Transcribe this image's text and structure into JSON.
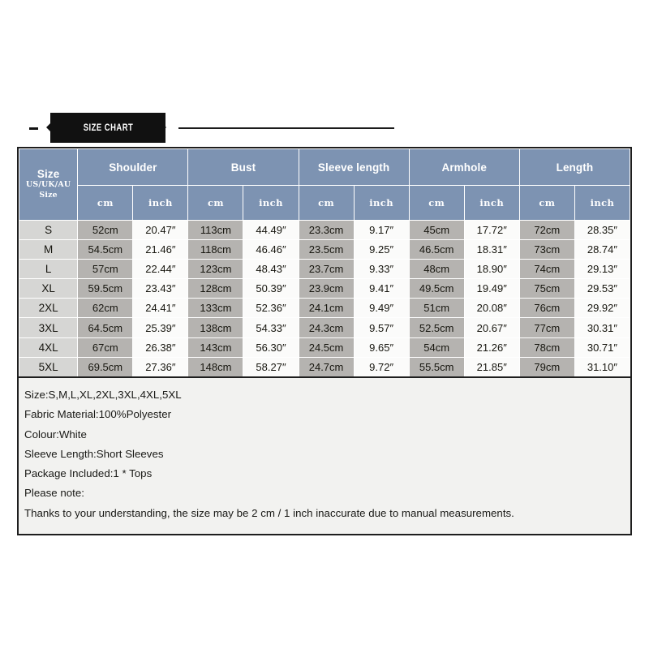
{
  "banner": {
    "title": "SIZE CHART",
    "accent_color": "#111111"
  },
  "theme": {
    "header_blue": "#7d93b2",
    "cm_cell_gray": "#b5b3b0",
    "inch_cell": "#fbfbfa",
    "size_cell_gray": "#d6d6d4",
    "border_dark": "#1e1e1e",
    "panel_bg": "#f2f2f0",
    "page_bg": "#ffffff"
  },
  "table": {
    "group_headers": [
      "Size",
      "Shoulder",
      "Bust",
      "Sleeve length",
      "Armhole",
      "Length"
    ],
    "size_subheader_line1": "US/UK/AU",
    "size_subheader_line2": "Size",
    "unit_headers": [
      "cm",
      "inch",
      "cm",
      "inch",
      "cm",
      "inch",
      "cm",
      "inch",
      "cm",
      "inch"
    ],
    "rows": [
      {
        "size": "S",
        "shoulder_cm": "52cm",
        "shoulder_inch": "20.47″",
        "bust_cm": "113cm",
        "bust_inch": "44.49″",
        "sleeve_cm": "23.3cm",
        "sleeve_inch": "9.17″",
        "armhole_cm": "45cm",
        "armhole_inch": "17.72″",
        "length_cm": "72cm",
        "length_inch": "28.35″"
      },
      {
        "size": "M",
        "shoulder_cm": "54.5cm",
        "shoulder_inch": "21.46″",
        "bust_cm": "118cm",
        "bust_inch": "46.46″",
        "sleeve_cm": "23.5cm",
        "sleeve_inch": "9.25″",
        "armhole_cm": "46.5cm",
        "armhole_inch": "18.31″",
        "length_cm": "73cm",
        "length_inch": "28.74″"
      },
      {
        "size": "L",
        "shoulder_cm": "57cm",
        "shoulder_inch": "22.44″",
        "bust_cm": "123cm",
        "bust_inch": "48.43″",
        "sleeve_cm": "23.7cm",
        "sleeve_inch": "9.33″",
        "armhole_cm": "48cm",
        "armhole_inch": "18.90″",
        "length_cm": "74cm",
        "length_inch": "29.13″"
      },
      {
        "size": "XL",
        "shoulder_cm": "59.5cm",
        "shoulder_inch": "23.43″",
        "bust_cm": "128cm",
        "bust_inch": "50.39″",
        "sleeve_cm": "23.9cm",
        "sleeve_inch": "9.41″",
        "armhole_cm": "49.5cm",
        "armhole_inch": "19.49″",
        "length_cm": "75cm",
        "length_inch": "29.53″"
      },
      {
        "size": "2XL",
        "shoulder_cm": "62cm",
        "shoulder_inch": "24.41″",
        "bust_cm": "133cm",
        "bust_inch": "52.36″",
        "sleeve_cm": "24.1cm",
        "sleeve_inch": "9.49″",
        "armhole_cm": "51cm",
        "armhole_inch": "20.08″",
        "length_cm": "76cm",
        "length_inch": "29.92″"
      },
      {
        "size": "3XL",
        "shoulder_cm": "64.5cm",
        "shoulder_inch": "25.39″",
        "bust_cm": "138cm",
        "bust_inch": "54.33″",
        "sleeve_cm": "24.3cm",
        "sleeve_inch": "9.57″",
        "armhole_cm": "52.5cm",
        "armhole_inch": "20.67″",
        "length_cm": "77cm",
        "length_inch": "30.31″"
      },
      {
        "size": "4XL",
        "shoulder_cm": "67cm",
        "shoulder_inch": "26.38″",
        "bust_cm": "143cm",
        "bust_inch": "56.30″",
        "sleeve_cm": "24.5cm",
        "sleeve_inch": "9.65″",
        "armhole_cm": "54cm",
        "armhole_inch": "21.26″",
        "length_cm": "78cm",
        "length_inch": "30.71″"
      },
      {
        "size": "5XL",
        "shoulder_cm": "69.5cm",
        "shoulder_inch": "27.36″",
        "bust_cm": "148cm",
        "bust_inch": "58.27″",
        "sleeve_cm": "24.7cm",
        "sleeve_inch": "9.72″",
        "armhole_cm": "55.5cm",
        "armhole_inch": "21.85″",
        "length_cm": "79cm",
        "length_inch": "31.10″"
      }
    ]
  },
  "description": {
    "lines": [
      "Size:S,M,L,XL,2XL,3XL,4XL,5XL",
      "Fabric Material:100%Polyester",
      "Colour:White",
      "Sleeve Length:Short Sleeves",
      "Package Included:1 * Tops",
      "Please note:",
      "Thanks to your understanding, the size may be 2 cm / 1 inch inaccurate due to manual measurements."
    ]
  }
}
